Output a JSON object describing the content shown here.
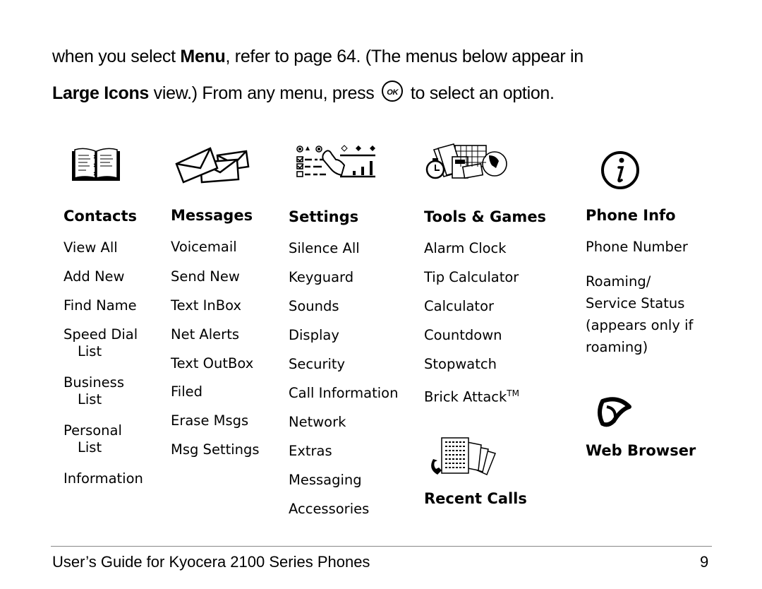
{
  "intro": {
    "line1_pre": "when you select ",
    "line1_bold": "Menu",
    "line1_post": ", refer to page 64. (The menus below appear in",
    "line2_bold": "Large Icons",
    "line2_pre": " view.) From any menu, press ",
    "ok_key": "OK",
    "line2_post": " to select an option."
  },
  "menus": {
    "contacts": {
      "icon": "address-book-icon",
      "title": "Contacts",
      "items": [
        "View All",
        "Add New",
        "Find Name",
        "Speed Dial",
        "List",
        "Business",
        "List",
        "Personal",
        "List",
        "Information"
      ]
    },
    "messages": {
      "icon": "envelopes-icon",
      "title": "Messages",
      "items": [
        "Voicemail",
        "Send New",
        "Text InBox",
        "Net Alerts",
        "Text OutBox",
        "Filed",
        "Erase Msgs",
        "Msg Settings"
      ]
    },
    "settings": {
      "icon": "settings-controls-icon",
      "title": "Settings",
      "items": [
        "Silence All",
        "Keyguard",
        "Sounds",
        "Display",
        "Security",
        "Call Information",
        "Network",
        "Extras",
        "Messaging",
        "Accessories"
      ]
    },
    "tools": {
      "icon": "tools-games-icon",
      "title": "Tools & Games",
      "items": [
        "Alarm Clock",
        "Tip Calculator",
        "Calculator",
        "Countdown",
        "Stopwatch",
        "Brick Attack"
      ],
      "trademark": "TM"
    },
    "phone_info": {
      "icon": "info-icon",
      "title": "Phone Info",
      "items": [
        "Phone Number",
        "Roaming/",
        "Service Status",
        "(appears only if",
        "roaming)"
      ]
    },
    "recent_calls": {
      "icon": "phone-call-list-icon",
      "title": "Recent Calls"
    },
    "web_browser": {
      "icon": "web-browser-icon",
      "title": "Web Browser"
    }
  },
  "footer": {
    "title": "User’s Guide for Kyocera 2100 Series Phones",
    "page_number": "9"
  }
}
